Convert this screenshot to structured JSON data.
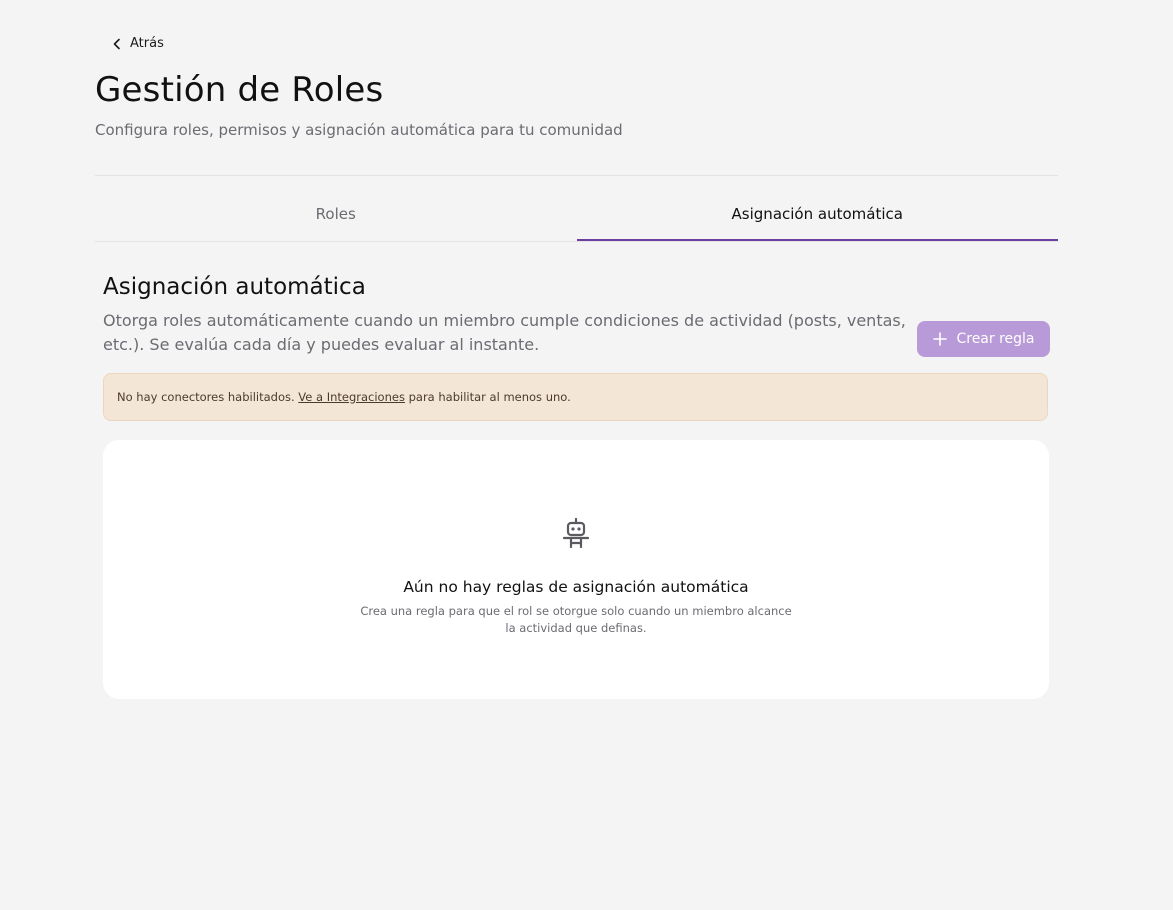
{
  "back": {
    "label": "Atrás",
    "icon": "chevron-left-icon"
  },
  "header": {
    "title": "Gestión de Roles",
    "subtitle": "Configura roles, permisos y asignación automática para tu comunidad"
  },
  "tabs": [
    {
      "label": "Roles",
      "active": false
    },
    {
      "label": "Asignación automática",
      "active": true
    }
  ],
  "section": {
    "title": "Asignación automática",
    "description": "Otorga roles automáticamente cuando un miembro cumple condiciones de actividad (posts, ventas, etc.). Se evalúa cada día y puedes evaluar al instante.",
    "create_button": {
      "label": "Crear regla",
      "icon": "plus-icon"
    }
  },
  "alert": {
    "prefix": "No hay conectores habilitados. ",
    "link": "Ve a Integraciones",
    "suffix": " para habilitar al menos uno."
  },
  "empty_state": {
    "icon": "robot-icon",
    "title": "Aún no hay reglas de asignación automática",
    "description": "Crea una regla para que el rol se otorgue solo cuando un miembro alcance la actividad que definas."
  },
  "colors": {
    "background": "#f4f4f4",
    "accent": "#6d3fa3",
    "button_bg": "#b99ad8",
    "alert_bg": "#f4e6d6"
  }
}
